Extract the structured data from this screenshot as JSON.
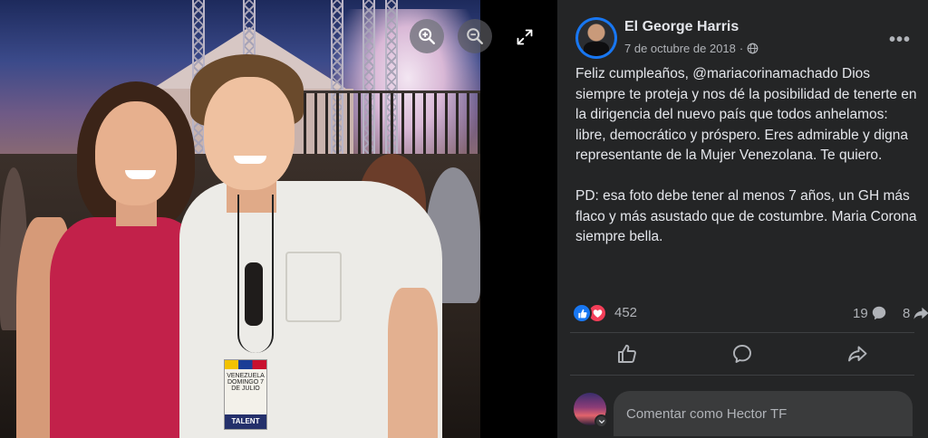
{
  "viewer": {
    "zoom_in_icon": "zoom-in-icon",
    "zoom_out_icon": "zoom-out-icon",
    "expand_icon": "expand-icon",
    "photo": {
      "badge_text": "VENEZUELA DOMINGO 7 DE JULIO",
      "badge_label": "TALENT"
    }
  },
  "post": {
    "author": "El George Harris",
    "date": "7 de octubre de 2018",
    "separator": "·",
    "privacy_icon": "globe-icon",
    "more_icon": "more-icon",
    "more_label": "•••",
    "text": "Feliz cumpleaños, @mariacorinamachado Dios siempre te proteja y nos dé la posibilidad de tenerte en la dirigencia del nuevo país que todos anhelamos: libre, democrático y próspero. Eres admirable y digna representante de la Mujer Venezolana. Te quiero.\n\nPD: esa foto debe tener al menos 7 años, un GH más flaco y más asustado que de costumbre. Maria Corona siempre bella."
  },
  "stats": {
    "reactions_count": "452",
    "comments_count": "19",
    "shares_count": "8"
  },
  "actions": {
    "like_icon": "thumbs-up-icon",
    "comment_icon": "comment-icon",
    "share_icon": "share-icon"
  },
  "comment_box": {
    "placeholder": "Comentar como Hector TF"
  },
  "colors": {
    "background": "#18191a",
    "panel": "#242526",
    "accent": "#1877f2",
    "love": "#f33e58",
    "text_primary": "#e4e6eb",
    "text_secondary": "#b0b3b8"
  }
}
